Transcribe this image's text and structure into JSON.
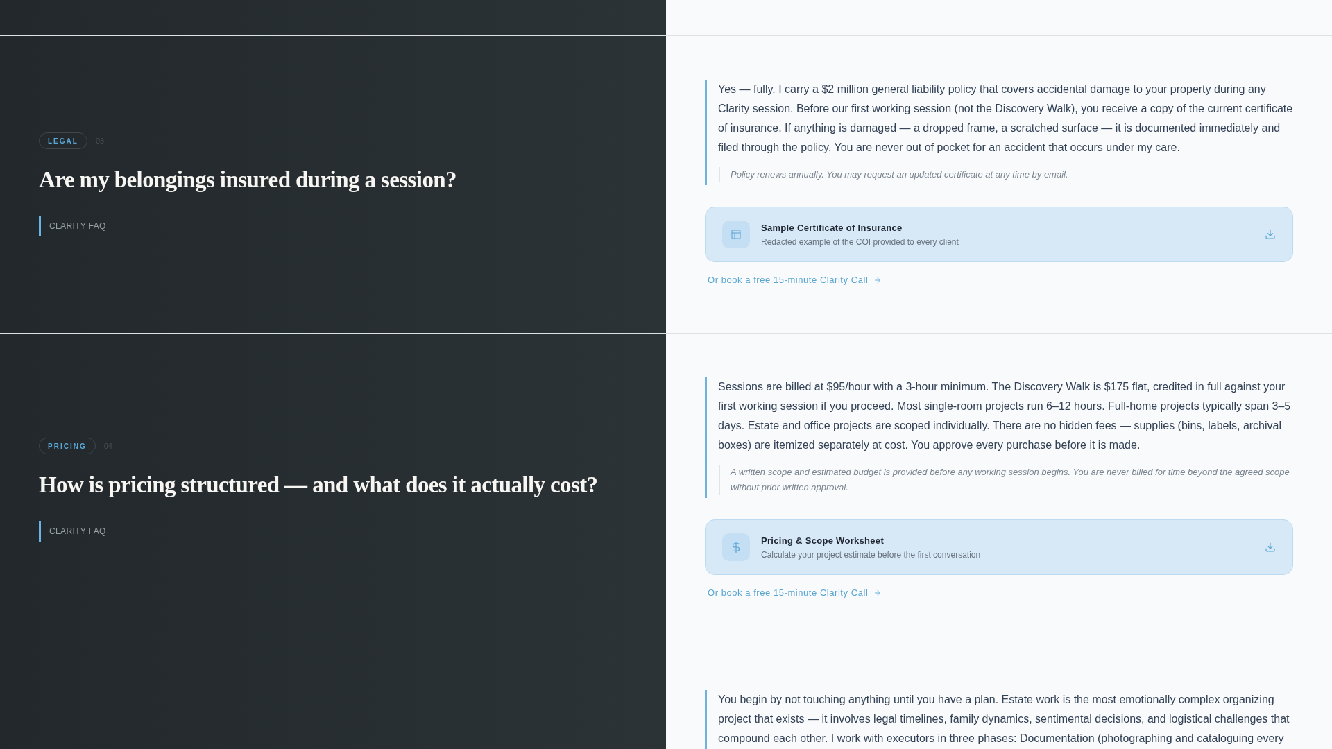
{
  "faq_items": [
    {
      "category": "LEGAL",
      "number": "03",
      "question": "Are my belongings insured during a session?",
      "source": "CLARITY FAQ",
      "answer": "Yes — fully. I carry a $2 million general liability policy that covers accidental damage to your property during any Clarity session. Before our first working session (not the Discovery Walk), you receive a copy of the current certificate of insurance. If anything is damaged — a dropped frame, a scratched surface — it is documented immediately and filed through the policy. You are never out of pocket for an accident that occurs under my care.",
      "note": "Policy renews annually. You may request an updated certificate at any time by email.",
      "resource": {
        "kind": "document",
        "title": "Sample Certificate of Insurance",
        "description": "Redacted example of the COI provided to every client"
      },
      "cta": "Or book a free 15-minute Clarity Call"
    },
    {
      "category": "PRICING",
      "number": "04",
      "question": "How is pricing structured — and what does it actually cost?",
      "source": "CLARITY FAQ",
      "answer": "Sessions are billed at $95/hour with a 3-hour minimum. The Discovery Walk is $175 flat, credited in full against your first working session if you proceed. Most single-room projects run 6–12 hours. Full-home projects typically span 3–5 days. Estate and office projects are scoped individually. There are no hidden fees — supplies (bins, labels, archival boxes) are itemized separately at cost. You approve every purchase before it is made.",
      "note": "A written scope and estimated budget is provided before any working session begins. You are never billed for time beyond the agreed scope without prior written approval.",
      "resource": {
        "kind": "pricing",
        "title": "Pricing & Scope Worksheet",
        "description": "Calculate your project estimate before the first conversation"
      },
      "cta": "Or book a free 15-minute Clarity Call"
    },
    {
      "answer": "You begin by not touching anything until you have a plan. Estate work is the most emotionally complex organizing project that exists — it involves legal timelines, family dynamics, sentimental decisions, and logistical challenges that compound each other. I work with executors in three phases: Documentation (photographing and cataloguing every"
    }
  ]
}
